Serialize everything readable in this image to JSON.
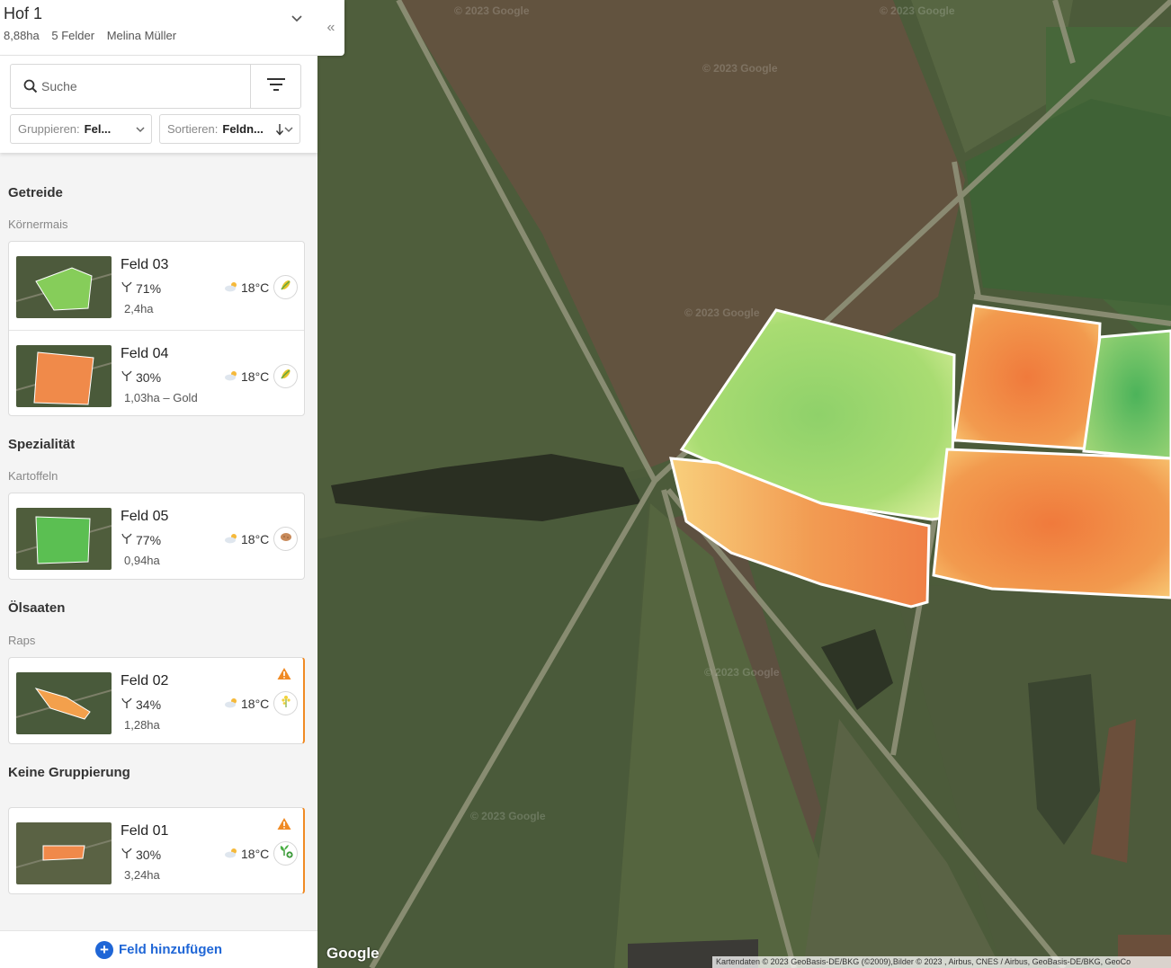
{
  "farm": {
    "title": "Hof 1",
    "area": "8,88ha",
    "fields": "5 Felder",
    "owner": "Melina Müller"
  },
  "search": {
    "placeholder": "Suche"
  },
  "group_by": {
    "label": "Gruppieren:",
    "value": "Fel..."
  },
  "sort_by": {
    "label": "Sortieren:",
    "value": "Feldn..."
  },
  "groups": [
    {
      "title": "Getreide",
      "subtitle": "Körnermais",
      "fields": [
        {
          "name": "Feld 03",
          "moisture": "71%",
          "temp": "18°C",
          "area": "2,4ha",
          "crop_icon": "corn-icon",
          "warning": false
        },
        {
          "name": "Feld 04",
          "moisture": "30%",
          "temp": "18°C",
          "area": "1,03ha – Gold",
          "crop_icon": "corn-icon",
          "warning": false
        }
      ]
    },
    {
      "title": "Spezialität",
      "subtitle": "Kartoffeln",
      "fields": [
        {
          "name": "Feld 05",
          "moisture": "77%",
          "temp": "18°C",
          "area": "0,94ha",
          "crop_icon": "potato-icon",
          "warning": false
        }
      ]
    },
    {
      "title": "Ölsaaten",
      "subtitle": "Raps",
      "fields": [
        {
          "name": "Feld 02",
          "moisture": "34%",
          "temp": "18°C",
          "area": "1,28ha",
          "crop_icon": "rapeseed-icon",
          "warning": true
        }
      ]
    },
    {
      "title": "Keine Gruppierung",
      "subtitle": "",
      "fields": [
        {
          "name": "Feld 01",
          "moisture": "30%",
          "temp": "18°C",
          "area": "3,24ha",
          "crop_icon": "seedling-add-icon",
          "warning": true
        }
      ]
    }
  ],
  "add_field": {
    "label": "Feld hinzufügen"
  },
  "map": {
    "logo": "Google",
    "watermark": "© 2023 Google",
    "attribution": "Kartendaten © 2023 GeoBasis-DE/BKG (©2009),Bilder © 2023 , Airbus, CNES / Airbus, GeoBasis-DE/BKG, GeoCo"
  },
  "colors": {
    "accent": "#1f66d6",
    "warning": "#f08a24",
    "healthy": "#6cc24a",
    "stressed": "#f07a3c"
  }
}
